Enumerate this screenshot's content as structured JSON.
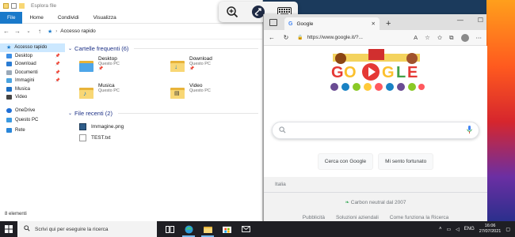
{
  "explorer": {
    "title": "Esplora file",
    "ribbon_tabs": [
      "File",
      "Home",
      "Condividi",
      "Visualizza"
    ],
    "address": "Accesso rapido",
    "sidebar": [
      {
        "label": "Accesso rapido",
        "icon": "star-icon",
        "pinned": false,
        "active": true
      },
      {
        "label": "Desktop",
        "icon": "desktop-folder-icon",
        "pinned": true
      },
      {
        "label": "Download",
        "icon": "download-folder-icon",
        "pinned": true
      },
      {
        "label": "Documenti",
        "icon": "documents-folder-icon",
        "pinned": true
      },
      {
        "label": "Immagini",
        "icon": "pictures-folder-icon",
        "pinned": true
      },
      {
        "label": "Musica",
        "icon": "music-folder-icon",
        "pinned": false
      },
      {
        "label": "Video",
        "icon": "video-folder-icon",
        "pinned": false
      },
      {
        "label": "OneDrive",
        "icon": "onedrive-icon",
        "pinned": false
      },
      {
        "label": "Questo PC",
        "icon": "pc-icon",
        "pinned": false
      },
      {
        "label": "Rete",
        "icon": "network-icon",
        "pinned": false
      }
    ],
    "frequent_header": "Cartelle frequenti (6)",
    "folders": [
      {
        "name": "Desktop",
        "location": "Questo PC",
        "icon": "desktop-folder-icon"
      },
      {
        "name": "Download",
        "location": "Questo PC",
        "icon": "download-folder-icon"
      },
      {
        "name": "Musica",
        "location": "Questo PC",
        "icon": "music-folder-icon"
      },
      {
        "name": "Video",
        "location": "Questo PC",
        "icon": "video-folder-icon"
      }
    ],
    "recent_header": "File recenti (2)",
    "recent_files": [
      {
        "name": "Immagine.png",
        "icon": "image-file-icon"
      },
      {
        "name": "TEST.txt",
        "icon": "text-file-icon"
      }
    ],
    "status": "8 elementi"
  },
  "browser": {
    "tab_title": "Google",
    "url": "https://www.google.it/?...",
    "search_placeholder": "",
    "buttons": [
      "Cerca con Google",
      "Mi sento fortunato"
    ],
    "country": "Italia",
    "carbon": "Carbon neutral dal 2007",
    "footer_links": [
      "Pubblicità",
      "Soluzioni aziendali",
      "Come funziona la Ricerca"
    ]
  },
  "taskbar": {
    "search_placeholder": "Scrivi qui per eseguire la ricerca",
    "language": "ENG",
    "time": "16:06",
    "date": "27/07/2021"
  },
  "colors": {
    "accent": "#1979ca",
    "explorer_selected": "#cce8ff",
    "taskbar": "#1f1f24"
  }
}
